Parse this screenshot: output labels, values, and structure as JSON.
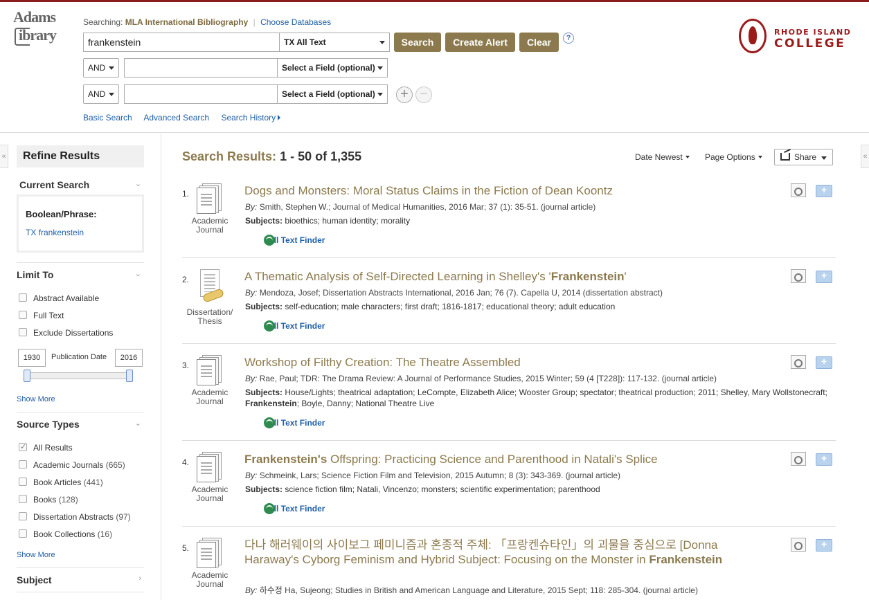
{
  "logo": {
    "line1": "Adams",
    "line2": "ibrary"
  },
  "header": {
    "searching_label": "Searching:",
    "database": "MLA International Bibliography",
    "choose_db": "Choose Databases",
    "query": "frankenstein",
    "field1": "TX All Text",
    "search_btn": "Search",
    "alert_btn": "Create Alert",
    "clear_btn": "Clear",
    "help": "?",
    "rows": [
      {
        "bool": "AND",
        "value": "",
        "field": "Select a Field (optional)"
      },
      {
        "bool": "AND",
        "value": "",
        "field": "Select a Field (optional)"
      }
    ],
    "plus": "+",
    "minus": "−",
    "links": {
      "basic": "Basic Search",
      "advanced": "Advanced Search",
      "history": "Search History"
    }
  },
  "college": {
    "line1": "RHODE ISLAND",
    "line2": "COLLEGE"
  },
  "colors": {
    "accent": "#8c7a4e",
    "link": "#1f5fa5",
    "brand": "#9b1b1b"
  },
  "sidebar": {
    "refine": "Refine Results",
    "current_search": "Current Search",
    "boolean_phrase": "Boolean/Phrase:",
    "current_term": "TX frankenstein",
    "limit_to": "Limit To",
    "limits": [
      "Abstract Available",
      "Full Text",
      "Exclude Dissertations"
    ],
    "year_from": "1930",
    "year_to": "2016",
    "pub_date": "Publication Date",
    "show_more": "Show More",
    "source_types": "Source Types",
    "sources": [
      {
        "label": "All Results",
        "count": "",
        "checked": true
      },
      {
        "label": "Academic Journals",
        "count": "(665)",
        "checked": false
      },
      {
        "label": "Book Articles",
        "count": "(441)",
        "checked": false
      },
      {
        "label": "Books",
        "count": "(128)",
        "checked": false
      },
      {
        "label": "Dissertation Abstracts",
        "count": "(97)",
        "checked": false
      },
      {
        "label": "Book Collections",
        "count": "(16)",
        "checked": false
      }
    ],
    "subject": "Subject"
  },
  "results": {
    "heading": "Search Results:",
    "range": "1 - 50 of 1,355",
    "sort": "Date Newest",
    "page_options": "Page Options",
    "share": "Share",
    "full_text_finder": "Full Text Finder",
    "by": "By:",
    "subjects_label": "Subjects:",
    "items": [
      {
        "num": "1.",
        "type_l1": "Academic",
        "type_l2": "Journal",
        "title_pre": "Dogs and Monsters: Moral Status Claims in the Fiction of Dean Koontz",
        "title_b": "",
        "title_post": "",
        "byline": "Smith, Stephen W.; Journal of Medical Humanities, 2016 Mar; 37 (1): 35-51. (journal article)",
        "subjects_pre": "bioethics; human identity; morality",
        "subjects_b": "",
        "subjects_post": ""
      },
      {
        "num": "2.",
        "type_l1": "Dissertation/",
        "type_l2": "Thesis",
        "title_pre": "A Thematic Analysis of Self-Directed Learning in Shelley's '",
        "title_b": "Frankenstein",
        "title_post": "'",
        "byline": "Mendoza, Josef; Dissertation Abstracts International, 2016 Jan; 76 (7). Capella U, 2014 (dissertation abstract)",
        "subjects_pre": "self-education; male characters; first draft; 1816-1817; educational theory; adult education",
        "subjects_b": "",
        "subjects_post": ""
      },
      {
        "num": "3.",
        "type_l1": "Academic",
        "type_l2": "Journal",
        "title_pre": "Workshop of Filthy Creation: The Theatre Assembled",
        "title_b": "",
        "title_post": "",
        "byline": "Rae, Paul; TDR: The Drama Review: A Journal of Performance Studies, 2015 Winter; 59 (4 [T228]): 117-132. (journal article)",
        "subjects_pre": "House/Lights; theatrical adaptation; LeCompte, Elizabeth Alice; Wooster Group; spectator; theatrical production; 2011; Shelley, Mary Wollstonecraft; ",
        "subjects_b": "Frankenstein",
        "subjects_post": "; Boyle, Danny; National Theatre Live"
      },
      {
        "num": "4.",
        "type_l1": "Academic",
        "type_l2": "Journal",
        "title_pre": "",
        "title_b": "Frankenstein's",
        "title_post": " Offspring: Practicing Science and Parenthood in Natali's Splice",
        "byline": "Schmeink, Lars; Science Fiction Film and Television, 2015 Autumn; 8 (3): 343-369. (journal article)",
        "subjects_pre": "science fiction film; Natali, Vincenzo; monsters; scientific experimentation; parenthood",
        "subjects_b": "",
        "subjects_post": ""
      },
      {
        "num": "5.",
        "type_l1": "Academic",
        "type_l2": "Journal",
        "title_pre": "다나 해러웨이의 사이보그 페미니즘과 혼종적 주체: 「프랑켄슈타인」의 괴물을 중심으로 [Donna Haraway's Cyborg Feminism and Hybrid Subject: Focusing on the Monster in ",
        "title_b": "Frankenstein",
        "title_post": "",
        "byline": "하수정 Ha, Sujeong; Studies in British and American Language and Literature, 2015 Sept; 118: 285-304. (journal article)",
        "subjects_pre": "",
        "subjects_b": "",
        "subjects_post": ""
      }
    ]
  }
}
